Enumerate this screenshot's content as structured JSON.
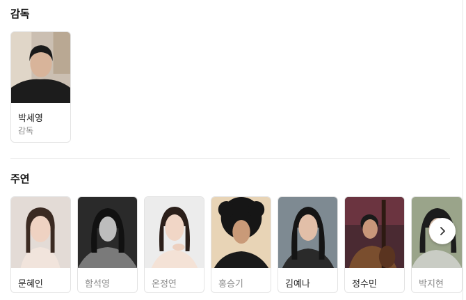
{
  "director_section": {
    "title": "감독",
    "people": [
      {
        "name": "박세영",
        "role": "감독"
      }
    ]
  },
  "cast_section": {
    "title": "주연",
    "people": [
      {
        "name": "문혜인"
      },
      {
        "name": "함석영"
      },
      {
        "name": "온정연"
      },
      {
        "name": "홍승기"
      },
      {
        "name": "김예나"
      },
      {
        "name": "정수민"
      },
      {
        "name": "박지현"
      }
    ],
    "next_icon": "chevron-right-icon"
  }
}
